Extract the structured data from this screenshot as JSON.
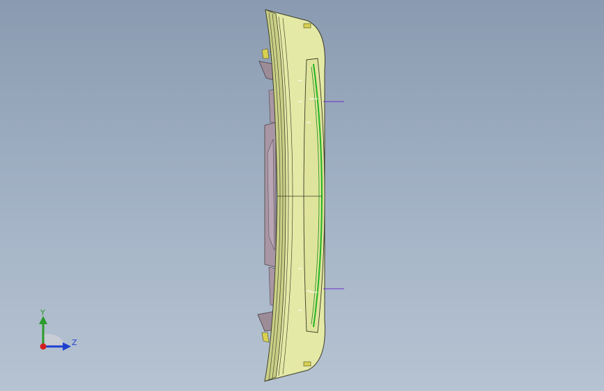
{
  "viewport": {
    "background_top": "#8a9ab0",
    "background_bottom": "#b6c3d2"
  },
  "model": {
    "body_color": "#e4e9a6",
    "shade_color": "#c9cf86",
    "edge_color": "#3a3c26",
    "bracket_color": "#9c8c98",
    "inner_line_color": "#22b322",
    "annotation_line_color": "#6a2fc8"
  },
  "triad": {
    "y_label": "Y",
    "z_label": "Z",
    "y_color": "#2b9b2b",
    "z_color": "#1f3fd0",
    "x_color": "#d22020"
  }
}
